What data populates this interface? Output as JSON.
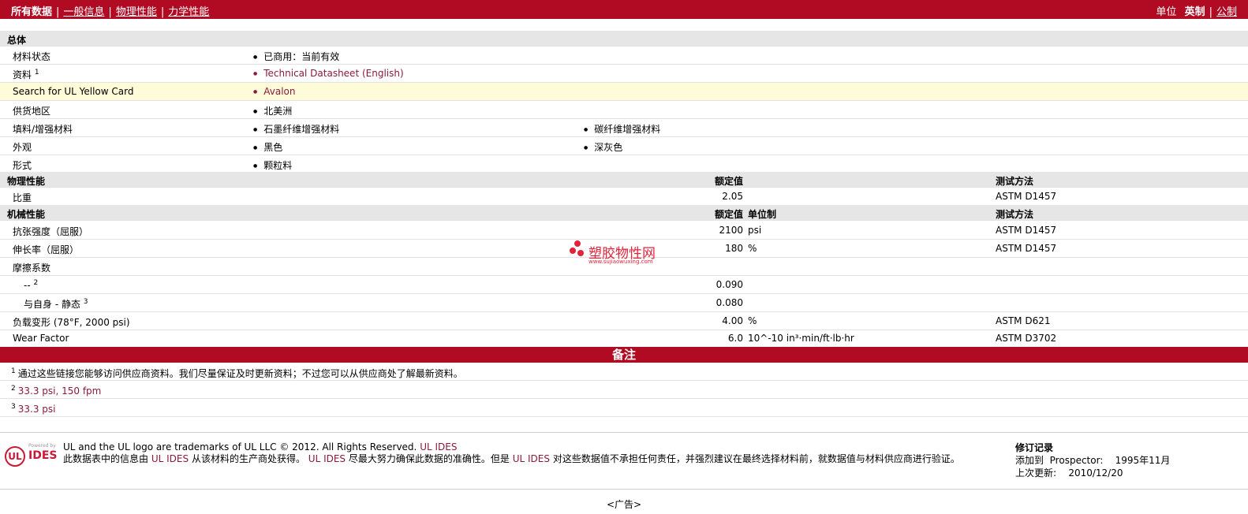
{
  "topbar": {
    "tabs": [
      "所有数据",
      "一般信息",
      "物理性能",
      "力学性能"
    ],
    "units_label": "单位",
    "unit_imperial": "英制",
    "unit_metric": "公制"
  },
  "general": {
    "title": "总体",
    "rows": [
      {
        "label": "材料状态",
        "sup": "",
        "values": [
          "已商用：当前有效"
        ]
      },
      {
        "label": "资料",
        "sup": "1",
        "values": [
          "Technical Datasheet (English)"
        ]
      },
      {
        "label": "Search for UL Yellow Card",
        "sup": "",
        "values": [
          "Avalon"
        ]
      },
      {
        "label": "供货地区",
        "sup": "",
        "values": [
          "北美洲"
        ]
      },
      {
        "label": "填料/增强材料",
        "sup": "",
        "values": [
          "石墨纤维增强材料",
          "碳纤维增强材料"
        ]
      },
      {
        "label": "外观",
        "sup": "",
        "values": [
          "黑色",
          "深灰色"
        ]
      },
      {
        "label": "形式",
        "sup": "",
        "values": [
          "颗粒料"
        ]
      }
    ]
  },
  "physical": {
    "title": "物理性能",
    "col_value": "额定值",
    "col_test": "测试方法",
    "rows": [
      {
        "label": "比重",
        "value": "2.05",
        "unit": "",
        "test": "ASTM D1457"
      }
    ]
  },
  "mechanical": {
    "title": "机械性能",
    "col_value": "额定值",
    "col_unit": "单位制",
    "col_test": "测试方法",
    "rows": [
      {
        "label": "抗张强度（屈服）",
        "value": "2100",
        "unit": "psi",
        "test": "ASTM D1457"
      },
      {
        "label": "伸长率（屈服）",
        "value": "180",
        "unit": "%",
        "test": "ASTM D1457"
      },
      {
        "label": "摩擦系数",
        "value": "",
        "unit": "",
        "test": ""
      },
      {
        "label": "--",
        "sup": "2",
        "value": "0.090",
        "unit": "",
        "test": ""
      },
      {
        "label": "与自身 - 静态",
        "sup": "3",
        "value": "0.080",
        "unit": "",
        "test": ""
      },
      {
        "label": "负载变形 (78°F, 2000 psi)",
        "value": "4.00",
        "unit": "%",
        "test": "ASTM D621"
      },
      {
        "label": "Wear Factor",
        "value": "6.0",
        "unit": "10^-10 in³·min/ft·lb·hr",
        "test": "ASTM D3702"
      }
    ]
  },
  "notes": {
    "title": "备注",
    "items": [
      {
        "num": "1",
        "text": "通过这些链接您能够访问供应商资料。我们尽量保证及时更新资料；不过您可以从供应商处了解最新资料。"
      },
      {
        "num": "2",
        "text": "33.3 psi, 150 fpm"
      },
      {
        "num": "3",
        "text": "33.3 psi"
      }
    ]
  },
  "footer": {
    "logo_powered": "Powered by",
    "logo_ul": "UL",
    "logo_ides": "IDES",
    "line1": "UL and the UL logo are trademarks of UL LLC © 2012. All Rights Reserved.",
    "line1_link": "UL IDES",
    "line2_a": "此数据表中的信息由",
    "line2_b": "UL IDES",
    "line2_c": "从该材料的生产商处获得。",
    "line2_d": "UL IDES",
    "line2_e": "尽最大努力确保此数据的准确性。但是",
    "line2_f": "UL IDES",
    "line2_g": "对这些数据值不承担任何责任，并强烈建议在最终选择材料前，就数据值与材料供应商进行验证。",
    "rev_title": "修订记录",
    "rev_added_label": "添加到",
    "rev_added_target": "Prospector:",
    "rev_added_date": "1995年11月",
    "rev_updated_label": "上次更新:",
    "rev_updated_date": "2010/12/20",
    "ad": "<广告>"
  },
  "watermark": {
    "name": "塑胶物性网",
    "url": "www.sujiaowuxing.com"
  },
  "colors": {
    "brand": "#b10a23",
    "link": "#8a1a3c",
    "highlight": "#fefbd8"
  }
}
